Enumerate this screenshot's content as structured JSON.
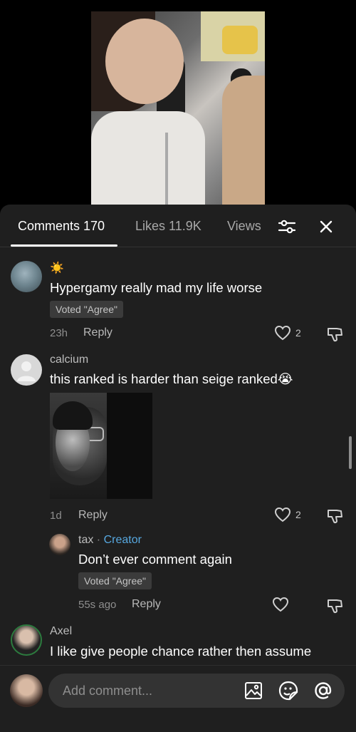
{
  "video": {
    "description_icon": "video-frame"
  },
  "tabs": [
    {
      "label": "Comments 170",
      "active": true
    },
    {
      "label": "Likes 11.9K",
      "active": false
    },
    {
      "label": "Views",
      "active": false
    }
  ],
  "icons": {
    "filter": "filter-sliders-icon",
    "close": "close-icon"
  },
  "comments": [
    {
      "username": "☀️",
      "text": "Hypergamy really mad my life worse",
      "vote": "Voted \"Agree\"",
      "time": "23h",
      "reply": "Reply",
      "likes": "2"
    },
    {
      "username": "calcium",
      "text": "this ranked is harder than seige ranked😭",
      "time": "1d",
      "reply": "Reply",
      "likes": "2"
    },
    {
      "username": "tax",
      "badge": "Creator",
      "text": "Don’t ever comment again",
      "vote": "Voted \"Agree\"",
      "time": "55s ago",
      "reply": "Reply"
    },
    {
      "username": "Axel",
      "text": "I like give people chance rather then assume"
    }
  ],
  "composer": {
    "placeholder": "Add comment..."
  }
}
